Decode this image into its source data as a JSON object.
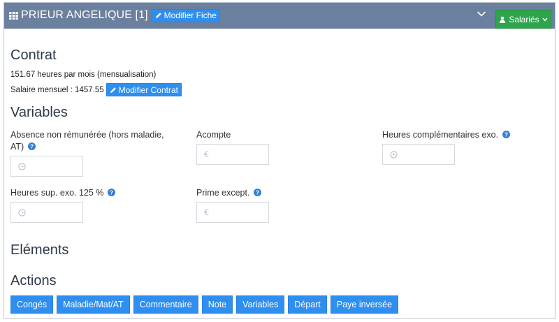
{
  "header": {
    "title": "PRIEUR ANGELIQUE [1]",
    "modify_sheet_label": "Modifier Fiche",
    "employees_label": "Salariés"
  },
  "contract": {
    "title": "Contrat",
    "hours_text": "151.67 heures par mois (mensualisation)",
    "salary_text": "Salaire mensuel : 1457.55",
    "modify_contract_label": "Modifier Contrat"
  },
  "variables": {
    "title": "Variables",
    "absence_label_line1": "Absence non rémunérée (hors maladie,",
    "absence_label_line2": "AT)",
    "deposit_label": "Acompte",
    "extra_hours_label": "Heures complémentaires exo.",
    "overtime_label": "Heures sup. exo. 125 %",
    "bonus_label": "Prime except.",
    "currency_symbol": "€"
  },
  "elements": {
    "title": "Eléments"
  },
  "actions": {
    "title": "Actions",
    "buttons": [
      "Congés",
      "Maladie/Mat/AT",
      "Commentaire",
      "Note",
      "Variables",
      "Départ",
      "Paye inversée"
    ]
  },
  "colors": {
    "header_bg": "#6b809e",
    "primary_blue": "#2f8ff0",
    "success_green": "#2ea44f"
  }
}
